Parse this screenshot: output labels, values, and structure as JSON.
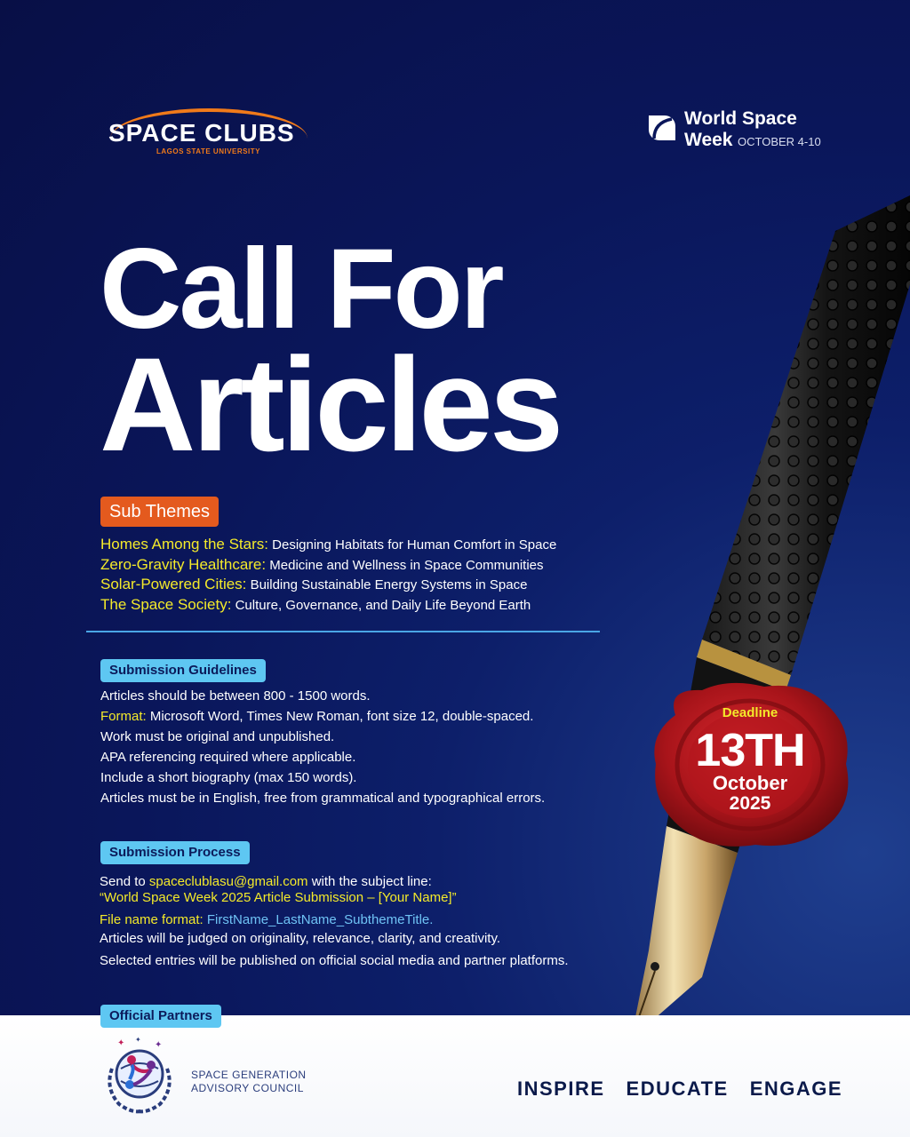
{
  "header": {
    "space_clubs": {
      "name": "SPACE CLUBS",
      "subtitle": "LAGOS STATE UNIVERSITY"
    },
    "world_space_week": {
      "line1": "World Space",
      "line2": "Week",
      "dates": "OCTOBER 4-10"
    }
  },
  "headline": {
    "line1": "Call For",
    "line2": "Articles"
  },
  "sub_themes": {
    "badge": "Sub Themes",
    "items": [
      {
        "title": "Homes Among the Stars:",
        "desc": " Designing Habitats for Human Comfort in Space"
      },
      {
        "title": "Zero-Gravity Healthcare:",
        "desc": " Medicine and Wellness in Space Communities"
      },
      {
        "title": "Solar-Powered Cities:",
        "desc": " Building Sustainable Energy Systems in Space"
      },
      {
        "title": "The Space Society:",
        "desc": " Culture, Governance, and Daily Life Beyond Earth"
      }
    ]
  },
  "guidelines": {
    "badge": "Submission Guidelines",
    "line1": "Articles should be between 800 - 1500 words.",
    "format_label": "Format:",
    "format_text": " Microsoft Word, Times New Roman, font size 12, double-spaced.",
    "line3": "Work must be original and unpublished.",
    "line4": "APA referencing required where applicable.",
    "line5": "Include a short biography (max 150 words).",
    "line6": "Articles must be in English, free from grammatical and typographical errors."
  },
  "process": {
    "badge": "Submission Process",
    "send_prefix": "Send to ",
    "email": "spaceclublasu@gmail.com",
    "send_suffix": " with the subject line:",
    "subject": "“World Space Week 2025 Article Submission – [Your Name]”",
    "filename_label": "File name format:",
    "filename_value": " FirstName_LastName_SubthemeTitle.",
    "line_judged": "Articles will be judged on originality, relevance, clarity, and creativity.",
    "line_selected": "Selected entries will be published on official social media and partner platforms."
  },
  "deadline": {
    "label": "Deadline",
    "day": "13TH",
    "month": "October",
    "year": "2025"
  },
  "partners": {
    "badge": "Official Partners",
    "org_line1": "SPACE GENERATION",
    "org_line2": "ADVISORY COUNCIL"
  },
  "tagline": [
    "INSPIRE",
    "EDUCATE",
    "ENGAGE"
  ],
  "colors": {
    "accent_orange": "#e45a1e",
    "highlight_yellow": "#f4ea2a",
    "badge_cyan": "#5ec7f2",
    "seal_red": "#b3161c",
    "background_navy": "#0a165a"
  }
}
